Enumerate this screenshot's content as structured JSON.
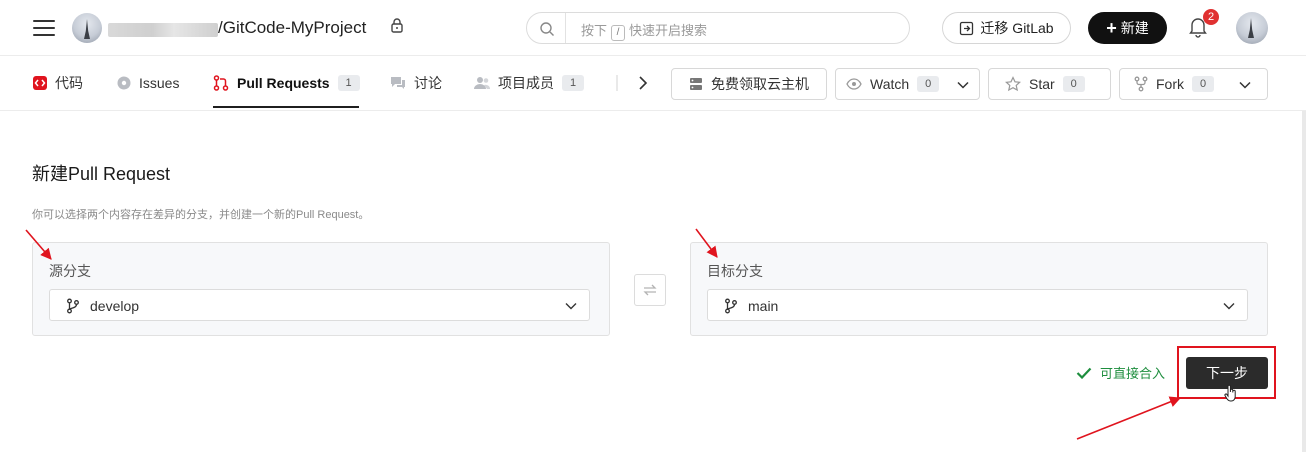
{
  "header": {
    "project_path": "/GitCode-MyProject",
    "search_placeholder_pre": "按下",
    "search_key": "/",
    "search_placeholder_post": "快速开启搜索",
    "migrate_label": "迁移 GitLab",
    "new_label": "新建",
    "notification_count": "2"
  },
  "tabs": [
    {
      "label": "代码",
      "icon": "code-icon"
    },
    {
      "label": "Issues",
      "icon": "issues-icon"
    },
    {
      "label": "Pull Requests",
      "count": "1",
      "icon": "pull-request-icon"
    },
    {
      "label": "讨论",
      "icon": "discussion-icon"
    },
    {
      "label": "项目成员",
      "count": "1",
      "icon": "members-icon"
    }
  ],
  "actions": {
    "free_host": "免费领取云主机",
    "watch": "Watch",
    "watch_count": "0",
    "star": "Star",
    "star_count": "0",
    "fork": "Fork",
    "fork_count": "0"
  },
  "main": {
    "title": "新建Pull Request",
    "description": "你可以选择两个内容存在差异的分支，并创建一个新的Pull Request。",
    "source": {
      "label": "源分支",
      "value": "develop"
    },
    "target": {
      "label": "目标分支",
      "value": "main"
    },
    "merge_status": "可直接合入",
    "next_label": "下一步"
  },
  "colors": {
    "accent": "#111111",
    "code_icon": "#e0141e",
    "success": "#1e8e3e",
    "annotation": "#e0141e"
  }
}
